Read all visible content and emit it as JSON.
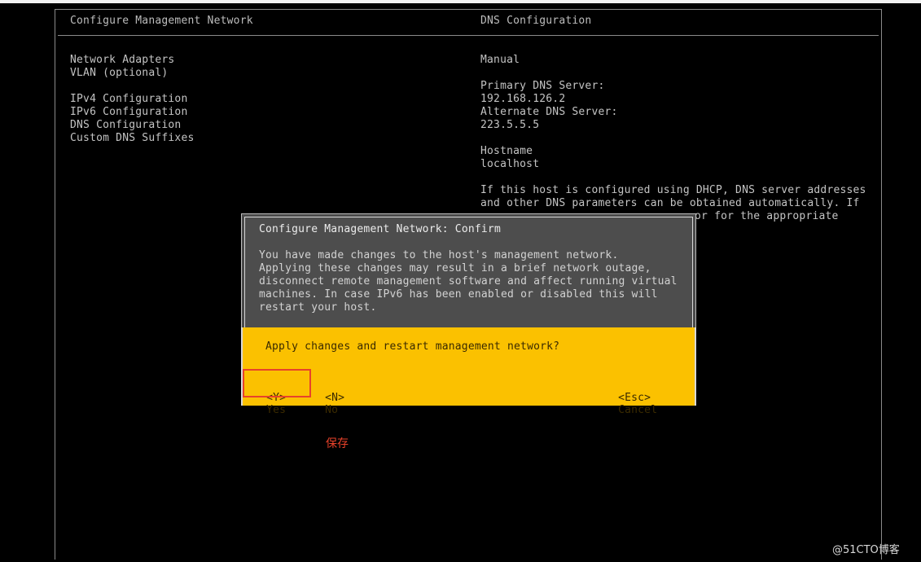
{
  "header": {
    "left_title": "Configure Management Network",
    "right_title": "DNS Configuration"
  },
  "menu": {
    "items": [
      "Network Adapters",
      "VLAN (optional)",
      "IPv4 Configuration",
      "IPv6 Configuration",
      "DNS Configuration",
      "Custom DNS Suffixes"
    ]
  },
  "details": {
    "mode": "Manual",
    "primary_dns_label": "Primary DNS Server:",
    "primary_dns_value": "192.168.126.2",
    "alternate_dns_label": "Alternate DNS Server:",
    "alternate_dns_value": "223.5.5.5",
    "hostname_label": "Hostname",
    "hostname_value": "localhost",
    "info_line1": "If this host is configured using DHCP, DNS server addresses",
    "info_line2": "and other DNS parameters can be obtained automatically. If",
    "info_line3": "or for the appropriate"
  },
  "dialog": {
    "title": "Configure Management Network: Confirm",
    "message_lines": [
      "You have made changes to the host's management network.",
      "Applying these changes may result in a brief network outage,",
      "disconnect remote management software and affect running virtual",
      "machines. In case IPv6 has been enabled or disabled this will",
      "restart your host."
    ],
    "question": "Apply changes and restart management network?",
    "yes_key": "<Y>",
    "yes_label": "Yes",
    "no_key": "<N>",
    "no_label": "No",
    "cancel_key": "<Esc>",
    "cancel_label": "Cancel"
  },
  "annotation": {
    "text": "保存",
    "color": "#e8422a"
  },
  "watermark": {
    "text": "@51CTO博客"
  }
}
